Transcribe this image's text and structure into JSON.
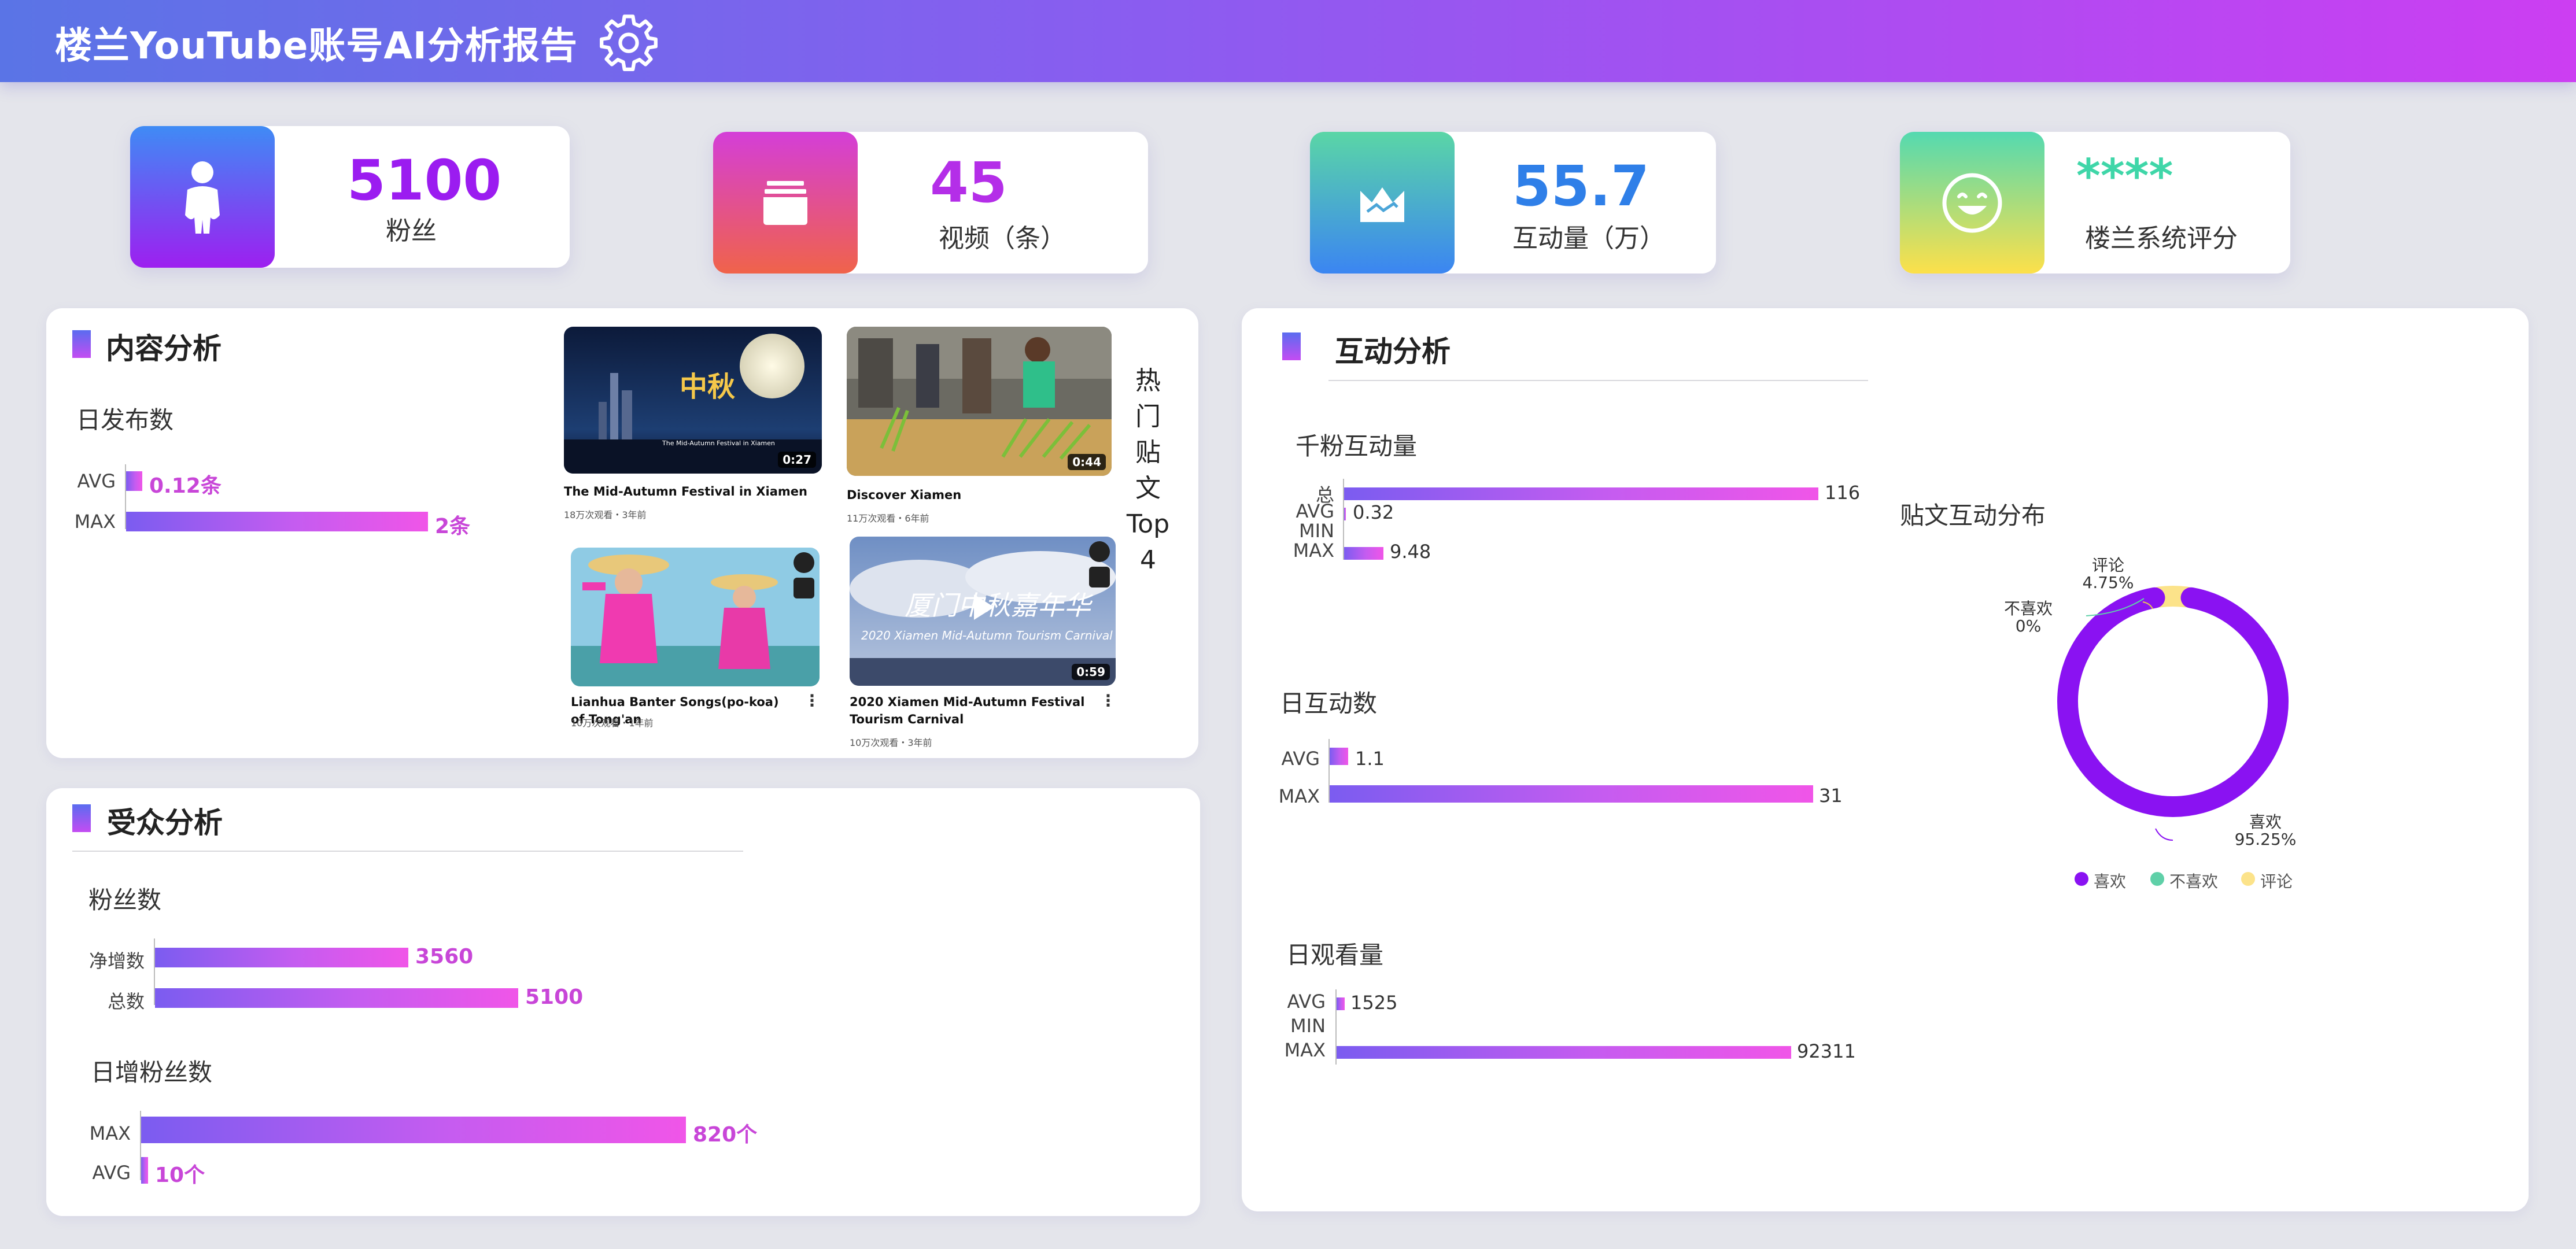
{
  "header": {
    "title": "楼兰YouTube账号AI分析报告"
  },
  "kpis": [
    {
      "value": "5100",
      "label": "粉丝",
      "color": "#9b1cf0",
      "icon": "user-icon"
    },
    {
      "value": "45",
      "label": "视频（条）",
      "color": "#b42ee8",
      "icon": "inbox-icon"
    },
    {
      "value": "55.7",
      "label": "互动量（万）",
      "color": "#2f7fe8",
      "icon": "crown-icon"
    },
    {
      "value": "****",
      "label": "楼兰系统评分",
      "color": "#3fd6a8",
      "icon": "smile-icon"
    }
  ],
  "content": {
    "title": "内容分析",
    "daily_posts": {
      "title": "日发布数",
      "rows": [
        {
          "label": "AVG",
          "value": "0.12条"
        },
        {
          "label": "MAX",
          "value": "2条"
        }
      ]
    },
    "top_label": [
      "热",
      "门",
      "贴",
      "文",
      "Top",
      "4"
    ],
    "videos": [
      {
        "title": "The Mid-Autumn Festival in Xiamen",
        "meta": "18万次观看・3年前",
        "duration": "0:27"
      },
      {
        "title": "Discover Xiamen",
        "meta": "11万次观看・6年前",
        "duration": "0:44"
      },
      {
        "title": "Lianhua Banter Songs(po-koa) of Tong'an",
        "meta": "10万次观看・1年前",
        "duration": ""
      },
      {
        "title": "2020 Xiamen Mid-Autumn Festival Tourism Carnival",
        "meta": "10万次观看・3年前",
        "duration": "0:59"
      }
    ]
  },
  "audience": {
    "title": "受众分析",
    "fans": {
      "title": "粉丝数",
      "rows": [
        {
          "label": "净增数",
          "value": "3560",
          "num": 3560
        },
        {
          "label": "总数",
          "value": "5100",
          "num": 5100
        }
      ]
    },
    "daily_fans": {
      "title": "日增粉丝数",
      "rows": [
        {
          "label": "MAX",
          "value": "820个",
          "num": 820
        },
        {
          "label": "AVG",
          "value": "10个",
          "num": 10
        }
      ]
    }
  },
  "interaction": {
    "title": "互动分析",
    "per_k": {
      "title": "千粉互动量",
      "rows": [
        {
          "label": "总",
          "value": "116",
          "num": 116
        },
        {
          "label": "AVG",
          "value": "0.32",
          "num": 0.32
        },
        {
          "label": "MIN",
          "value": "",
          "num": 0
        },
        {
          "label": "MAX",
          "value": "9.48",
          "num": 9.48
        }
      ]
    },
    "daily": {
      "title": "日互动数",
      "rows": [
        {
          "label": "AVG",
          "value": "1.1",
          "num": 1.1
        },
        {
          "label": "MAX",
          "value": "31",
          "num": 31
        }
      ]
    },
    "views": {
      "title": "日观看量",
      "rows": [
        {
          "label": "AVG",
          "value": "1525",
          "num": 1525
        },
        {
          "label": "MIN",
          "value": "",
          "num": 0
        },
        {
          "label": "MAX",
          "value": "92311",
          "num": 92311
        }
      ]
    },
    "distribution": {
      "title": "贴文互动分布",
      "slices": [
        {
          "name": "喜欢",
          "pct": "95.25%",
          "value": 95.25,
          "color": "#8a12f2"
        },
        {
          "name": "不喜欢",
          "pct": "0%",
          "value": 0,
          "color": "#5fd0a8"
        },
        {
          "name": "评论",
          "pct": "4.75%",
          "value": 4.75,
          "color": "#fce38a"
        }
      ]
    }
  }
}
